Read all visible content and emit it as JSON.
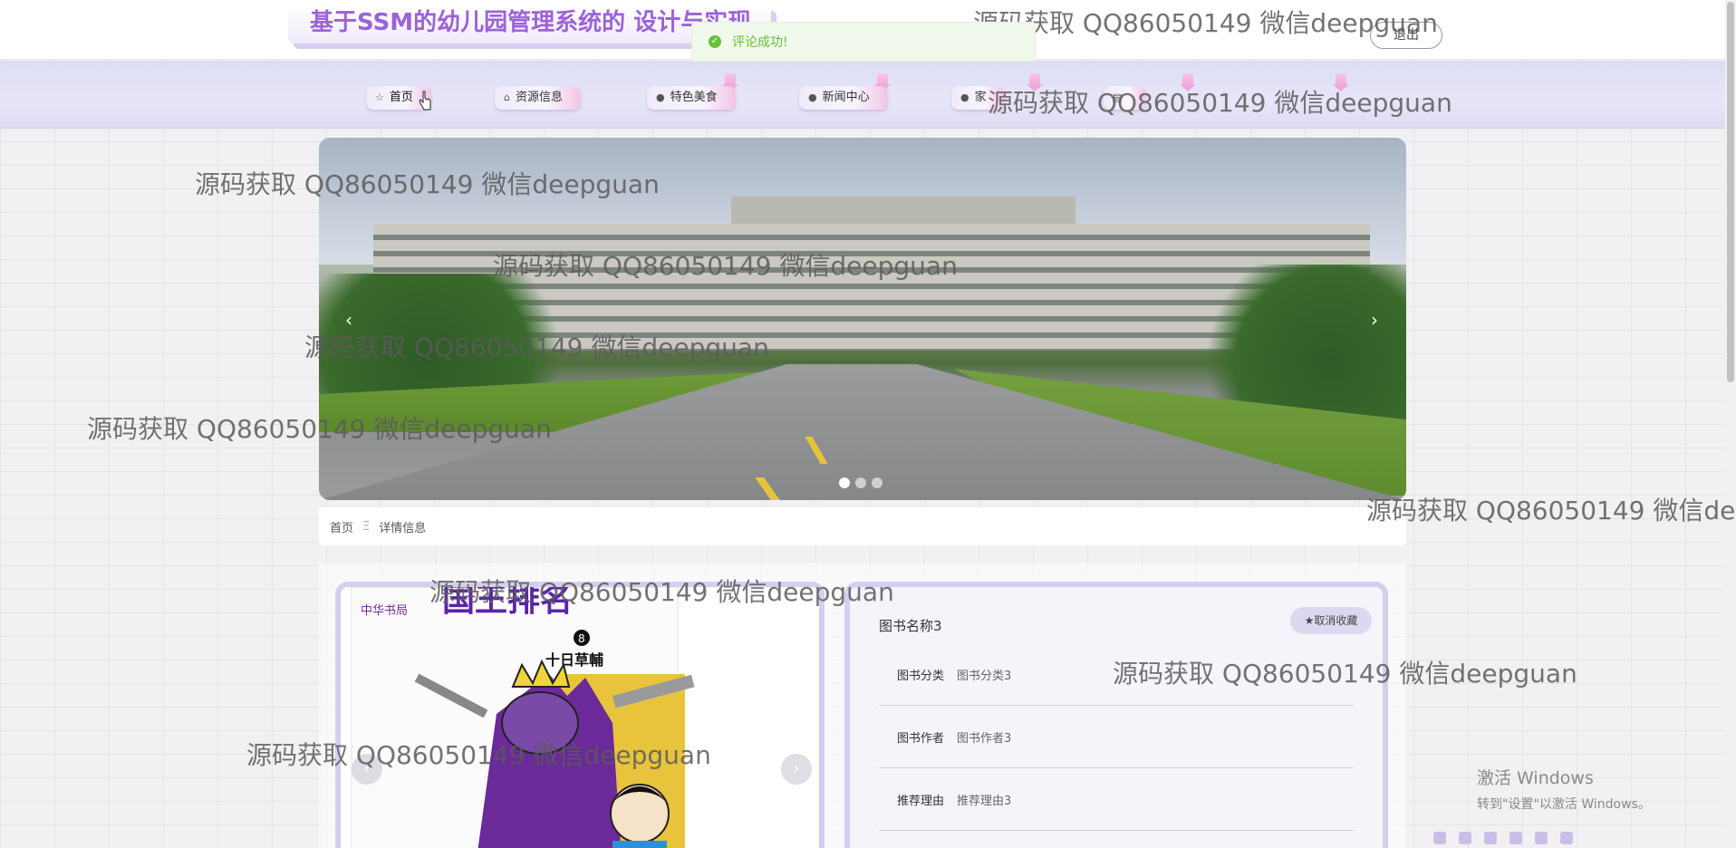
{
  "header": {
    "site_title": "基于SSM的幼儿园管理系统的 设计与实现",
    "logout_label": "退出"
  },
  "toast": {
    "message": "评论成功!",
    "icon": "check-circle-icon",
    "color": "#67c23a"
  },
  "nav": {
    "items": [
      {
        "label": "首页",
        "icon": "star-icon"
      },
      {
        "label": "资源信息",
        "icon": "lock-icon"
      },
      {
        "label": "特色美食",
        "icon": "info-icon"
      },
      {
        "label": "新闻中心",
        "icon": "question-icon"
      },
      {
        "label": "家",
        "icon": "info-icon"
      },
      {
        "label": "",
        "icon": "doc-icon"
      }
    ]
  },
  "banner": {
    "prev_label": "‹",
    "next_label": "›",
    "slides": 3,
    "active_slide": 1
  },
  "breadcrumb": {
    "home": "首页",
    "separator": "Ξ",
    "current": "详情信息"
  },
  "detail": {
    "book_name": "图书名称3",
    "fav_label": "★取消收藏",
    "rows": [
      {
        "key": "图书分类",
        "value": "图书分类3"
      },
      {
        "key": "图书作者",
        "value": "图书作者3"
      },
      {
        "key": "推荐理由",
        "value": "推荐理由3"
      }
    ],
    "gallery_prev": "‹",
    "gallery_next": "›",
    "cover_publisher": "中华书局",
    "cover_title": "国王排名",
    "cover_volume": "8",
    "cover_subtitle": "十日草輔"
  },
  "watermark": {
    "text": "源码获取 QQ86050149 微信deepguan"
  },
  "windows_activation": {
    "line1": "激活 Windows",
    "line2": "转到\"设置\"以激活 Windows。"
  },
  "colors": {
    "accent": "#9b63d8",
    "nav_bg": "#e0def6",
    "card_border": "#d4cff0"
  }
}
